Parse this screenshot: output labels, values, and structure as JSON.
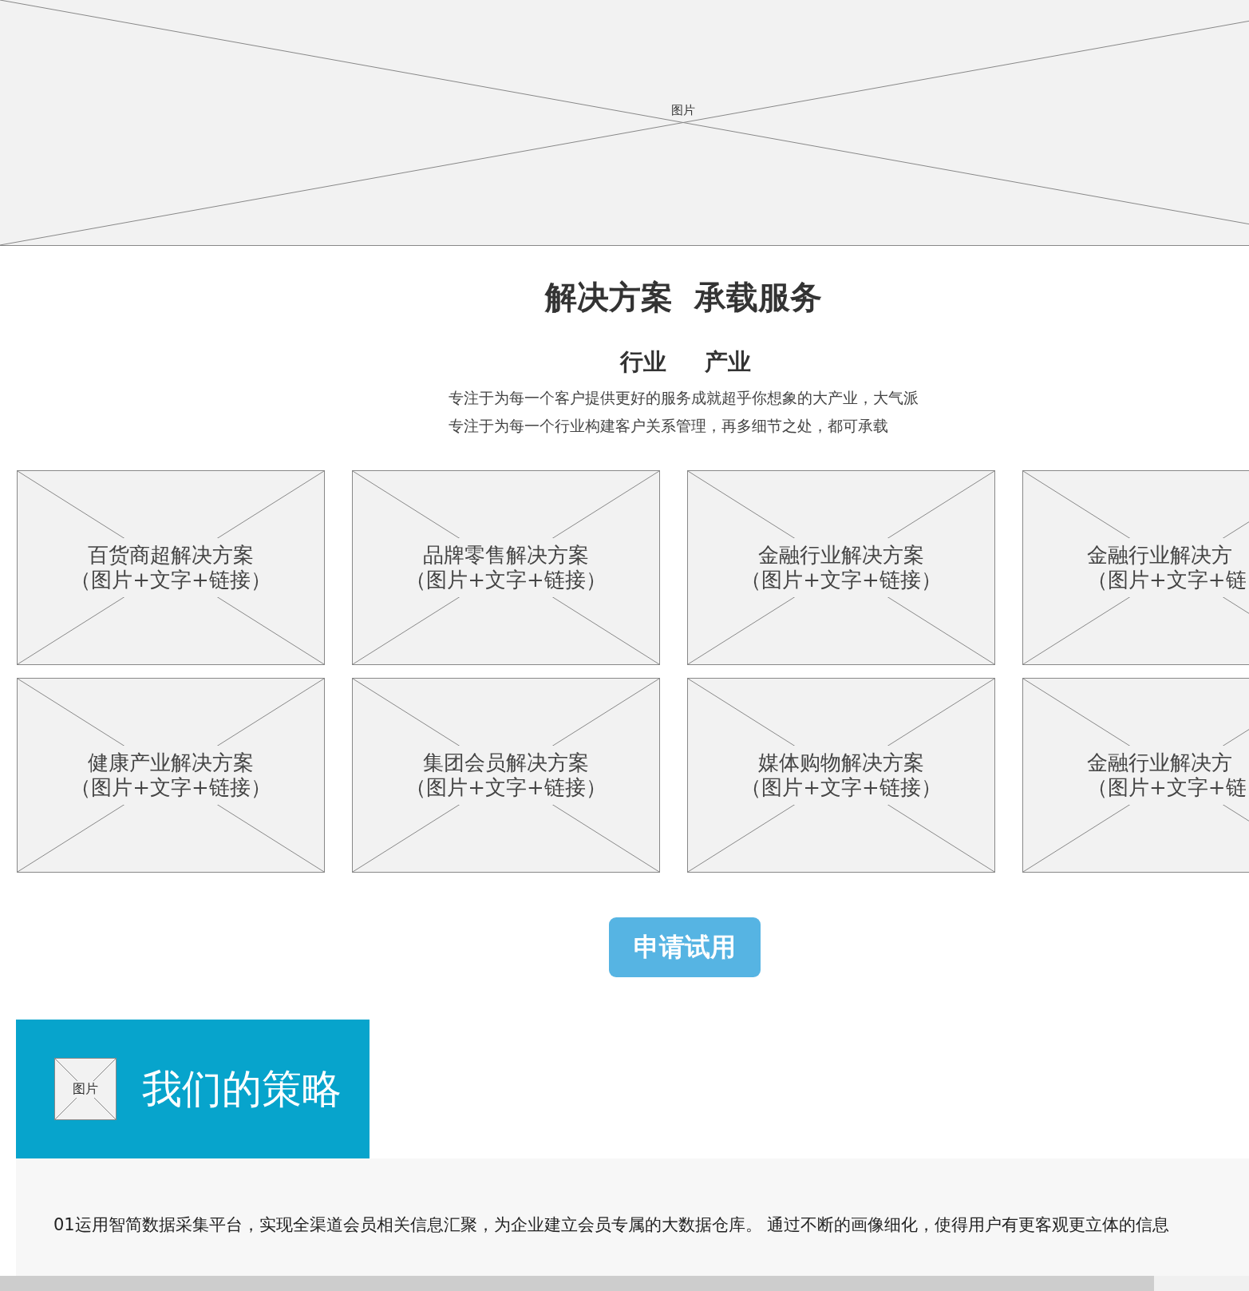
{
  "banner": {
    "label": "图片"
  },
  "section": {
    "title": "解决方案  承载服务",
    "tabs": [
      "行业",
      "产业"
    ],
    "description": [
      "专注于为每一个客户提供更好的服务成就超乎你想象的大产业，大气派",
      "专注于为每一个行业构建客户关系管理，再多细节之处，都可承载"
    ]
  },
  "cards": [
    {
      "title": "百货商超解决方案",
      "subtitle": "（图片+文字+链接）"
    },
    {
      "title": "品牌零售解决方案",
      "subtitle": "（图片+文字+链接）"
    },
    {
      "title": "金融行业解决方案",
      "subtitle": "（图片+文字+链接）"
    },
    {
      "title": "金融行业解决方",
      "subtitle": "（图片+文字+链"
    },
    {
      "title": "健康产业解决方案",
      "subtitle": "（图片+文字+链接）"
    },
    {
      "title": "集团会员解决方案",
      "subtitle": "（图片+文字+链接）"
    },
    {
      "title": "媒体购物解决方案",
      "subtitle": "（图片+文字+链接）"
    },
    {
      "title": "金融行业解决方",
      "subtitle": "（图片+文字+链"
    }
  ],
  "cta_button": "申请试用",
  "strategy": {
    "icon_label": "图片",
    "title": "我们的策略",
    "text": "01运用智简数据采集平台，实现全渠道会员相关信息汇聚，为企业建立会员专属的大数据仓库。 通过不断的画像细化，使得用户有更客观更立体的信息"
  }
}
